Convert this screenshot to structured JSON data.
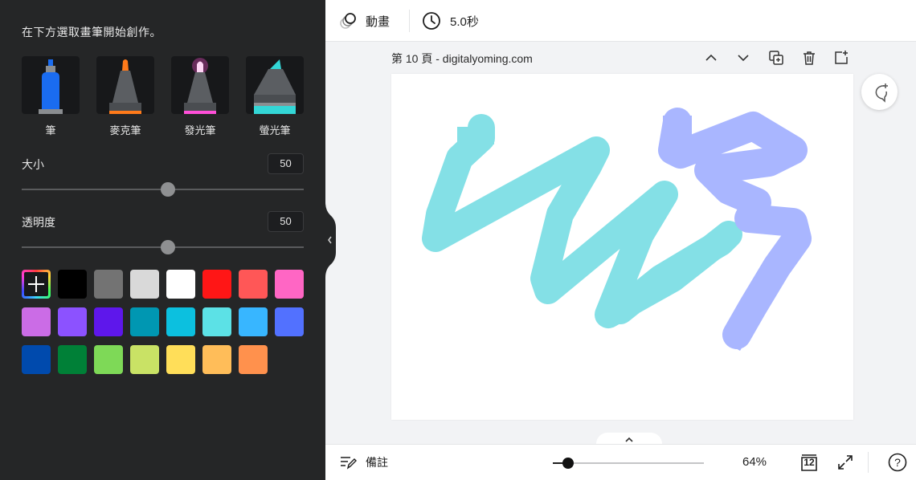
{
  "panel": {
    "hint": "在下方選取畫筆開始創作。",
    "tools": [
      {
        "label": "筆",
        "icon": "pen-icon",
        "tip_color": "#1a6cf0",
        "band_color": "#8a8d90"
      },
      {
        "label": "麥克筆",
        "icon": "marker-icon",
        "tip_color": "#ff7a1a",
        "band_color": "#ff7a1a"
      },
      {
        "label": "發光筆",
        "icon": "glow-pen-icon",
        "tip_color": "#ff4fd8",
        "band_color": "#ff4fd8"
      },
      {
        "label": "螢光筆",
        "icon": "highlighter-icon",
        "tip_color": "#33d6d6",
        "band_color": "#33d6d6"
      }
    ],
    "size": {
      "label": "大小",
      "value": "50",
      "level": 0.5
    },
    "opacity": {
      "label": "透明度",
      "value": "50",
      "level": 0.5
    },
    "add_color_icon": "plus-icon",
    "colors": [
      [
        "#000000",
        "#737373",
        "#d9d9d9",
        "#ffffff",
        "#ff1616",
        "#ff5757",
        "#ff66c4"
      ],
      [
        "#cb6ce6",
        "#8c52ff",
        "#5e17eb",
        "#0097b2",
        "#0cc0df",
        "#5ce1e6",
        "#38b6ff",
        "#5271ff"
      ],
      [
        "#004aad",
        "#008037",
        "#7ed957",
        "#c9e265",
        "#ffde59",
        "#ffbd59",
        "#ff914d"
      ]
    ],
    "collapse_icon": "chevron-left-icon"
  },
  "topbar": {
    "animate_icon": "animate-icon",
    "animate_label": "動畫",
    "timer_icon": "clock-icon",
    "duration": "5.0秒"
  },
  "page": {
    "title": "第 10 頁 - digitalyoming.com",
    "actions": [
      "chevron-up-icon",
      "chevron-down-icon",
      "duplicate-icon",
      "trash-icon",
      "add-page-icon"
    ],
    "stroke_colors": {
      "cyan": "#84e0e6",
      "periwinkle": "#a9b6ff"
    }
  },
  "comment_icon": "add-comment-icon",
  "bottombar": {
    "expand_icon": "chevron-up-icon",
    "notes_icon": "notes-icon",
    "notes_label": "備註",
    "zoom_level": 0.1,
    "zoom_percent": "64%",
    "page_count": "12",
    "fullscreen_icon": "fullscreen-icon",
    "help_icon": "help-icon",
    "help_glyph": "?"
  }
}
